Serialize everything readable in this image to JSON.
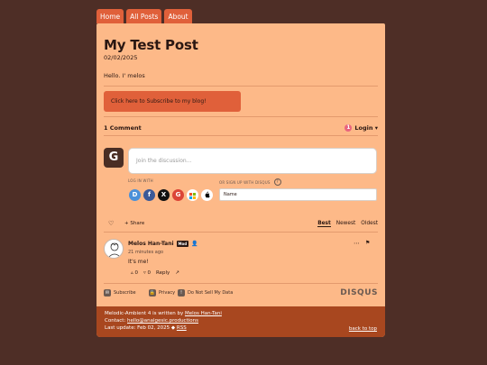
{
  "nav": {
    "tabs": [
      "Home",
      "All Posts",
      "About"
    ]
  },
  "post": {
    "title": "My Test Post",
    "date": "02/02/2025",
    "body": "Hello. I' melos",
    "subscribe_label": "Click here to Subscribe to my blog!"
  },
  "disqus": {
    "comment_count": "1 Comment",
    "login_label": "Login ▾",
    "login_badge": "1",
    "guest_avatar_letter": "G",
    "discussion_placeholder": "Join the discussion…",
    "login_with": "LOG IN WITH",
    "signup_with": "OR SIGN UP WITH DISQUS",
    "name_placeholder": "Name",
    "share_label": "Share",
    "sorts": [
      "Best",
      "Newest",
      "Oldest"
    ],
    "socials": [
      {
        "name": "disqus-icon",
        "glyph": "D",
        "color": "#4a90d9"
      },
      {
        "name": "facebook-icon",
        "glyph": "f",
        "color": "#3b5998"
      },
      {
        "name": "x-icon",
        "glyph": "X",
        "color": "#111111"
      },
      {
        "name": "google-icon",
        "glyph": "G",
        "color": "#db4437"
      },
      {
        "name": "microsoft-icon",
        "glyph": "▦",
        "color": "#ffffff"
      },
      {
        "name": "apple-icon",
        "glyph": "",
        "color": "#ffffff"
      }
    ],
    "comment": {
      "author": "Melos Han-Tani",
      "badge": "Mod",
      "time": "21 minutes ago",
      "text": "It's me!",
      "upvotes": "0",
      "downvotes": "0",
      "reply_label": "Reply"
    },
    "footer": {
      "subscribe": "Subscribe",
      "privacy": "Privacy",
      "do_not_sell": "Do Not Sell My Data",
      "brand": "DISQUS"
    }
  },
  "footer": {
    "written_by_prefix": "Melodic-Ambient 4 is written by ",
    "author_link": "Melos Han-Tani",
    "contact_prefix": "Contact: ",
    "contact_link": "hello@analgesic.productions",
    "last_update_prefix": "Last update: Feb 02, 2025 ◆ ",
    "rss_link": "RSS",
    "back_to_top": "back to top"
  },
  "colors": {
    "background": "#4e2e26",
    "card": "#fdb988",
    "accent": "#e0603a",
    "footer": "#a8471f"
  }
}
